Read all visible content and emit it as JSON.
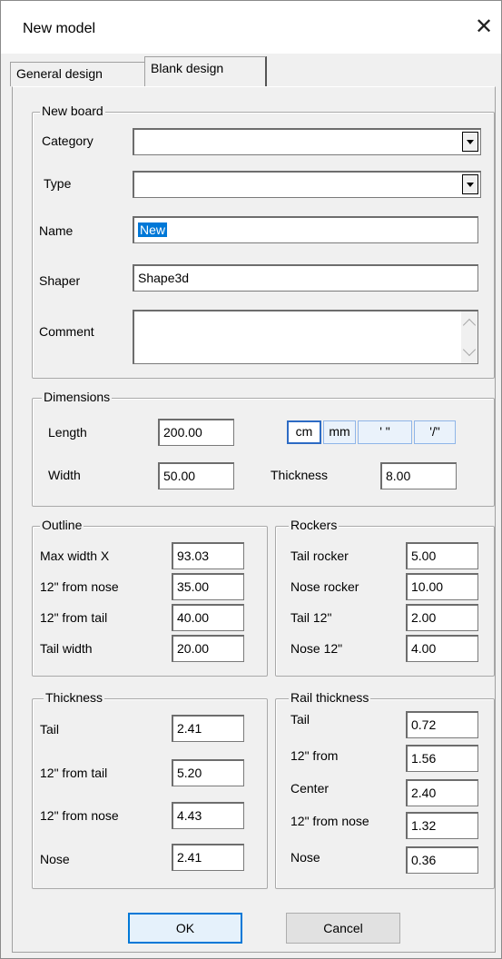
{
  "window": {
    "title": "New model"
  },
  "tabs": [
    "General design",
    "Blank design"
  ],
  "new_board": {
    "legend": "New board",
    "category_label": "Category",
    "category_value": "",
    "type_label": "Type",
    "type_value": "",
    "name_label": "Name",
    "name_value": "New",
    "shaper_label": "Shaper",
    "shaper_value": "Shape3d",
    "comment_label": "Comment",
    "comment_value": ""
  },
  "dimensions": {
    "legend": "Dimensions",
    "length_label": "Length",
    "length_value": "200.00",
    "width_label": "Width",
    "width_value": "50.00",
    "thickness_label": "Thickness",
    "thickness_value": "8.00",
    "units": [
      "cm",
      "mm",
      "' \"",
      "'/\""
    ]
  },
  "outline": {
    "legend": "Outline",
    "rows": [
      {
        "label": "Max width X",
        "value": "93.03"
      },
      {
        "label": "12\" from nose",
        "value": "35.00"
      },
      {
        "label": "12\" from tail",
        "value": "40.00"
      },
      {
        "label": "Tail width",
        "value": "20.00"
      }
    ]
  },
  "rockers": {
    "legend": "Rockers",
    "rows": [
      {
        "label": "Tail rocker",
        "value": "5.00"
      },
      {
        "label": "Nose rocker",
        "value": "10.00"
      },
      {
        "label": "Tail 12\"",
        "value": "2.00"
      },
      {
        "label": "Nose 12\"",
        "value": "4.00"
      }
    ]
  },
  "thickness": {
    "legend": "Thickness",
    "rows": [
      {
        "label": "Tail",
        "value": "2.41"
      },
      {
        "label": "12\" from tail",
        "value": "5.20"
      },
      {
        "label": "12\" from nose",
        "value": "4.43"
      },
      {
        "label": "Nose",
        "value": "2.41"
      }
    ]
  },
  "rail_thickness": {
    "legend": "Rail thickness",
    "rows": [
      {
        "label": "Tail",
        "value": "0.72"
      },
      {
        "label": "12\" from",
        "value": "1.56"
      },
      {
        "label": "Center",
        "value": "2.40"
      },
      {
        "label": "12\" from nose",
        "value": "1.32"
      },
      {
        "label": "Nose",
        "value": "0.36"
      }
    ]
  },
  "buttons": {
    "ok": "OK",
    "cancel": "Cancel"
  },
  "icons": {
    "close": "close-icon",
    "dropdown": "chevron-down-icon"
  }
}
